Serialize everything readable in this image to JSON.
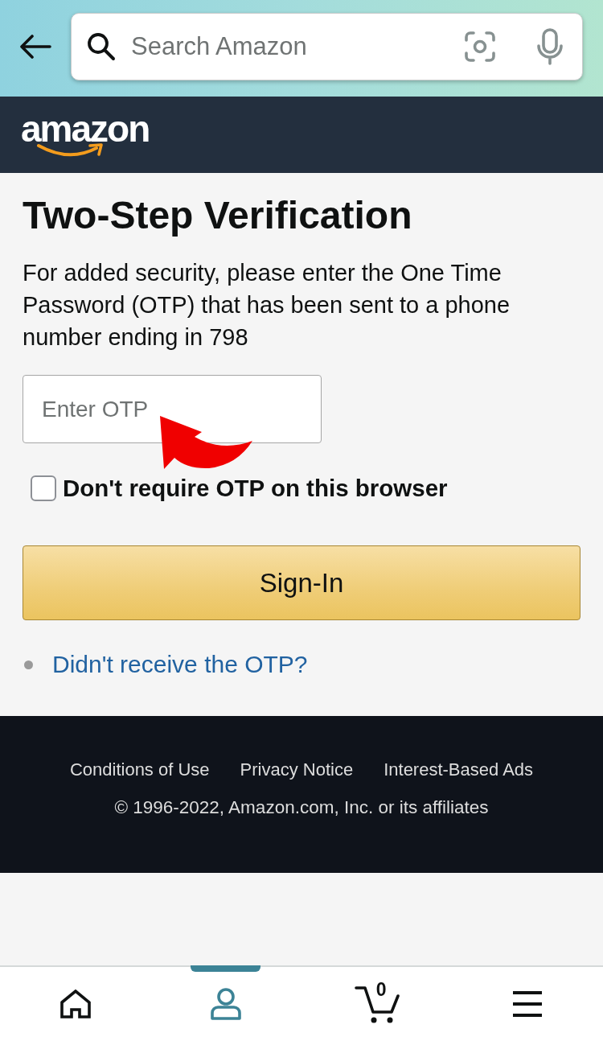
{
  "search_bar": {
    "placeholder": "Search Amazon"
  },
  "header": {
    "logo_text": "amazon"
  },
  "page": {
    "title": "Two-Step Verification",
    "instructions": "For added security, please enter the One Time Password (OTP) that has been sent to a phone number ending in 798",
    "otp_field": {
      "placeholder": "Enter OTP"
    },
    "annotation": {
      "kind": "curved_arrow"
    },
    "remember_checkbox": {
      "label": "Don't require OTP on this browser",
      "checked": false
    },
    "sign_in_button": "Sign-In",
    "help_links": [
      "Didn't receive the OTP?"
    ]
  },
  "footer": {
    "links": [
      "Conditions of Use",
      "Privacy Notice",
      "Interest-Based Ads"
    ],
    "copyright": "© 1996-2022, Amazon.com, Inc. or its affiliates"
  },
  "bottom_nav": [
    {
      "kind": "home",
      "selected": false
    },
    {
      "kind": "account",
      "selected": true
    },
    {
      "kind": "cart",
      "selected": false,
      "badge": "0"
    },
    {
      "kind": "menu",
      "selected": false
    }
  ]
}
